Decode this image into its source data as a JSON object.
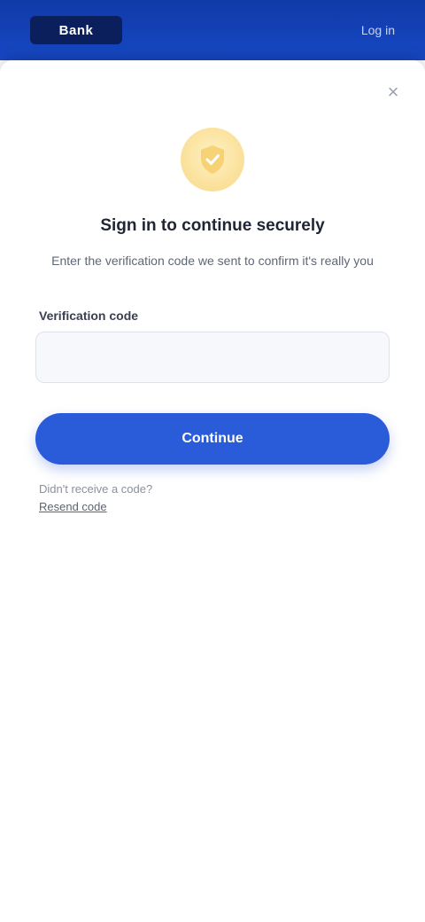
{
  "header": {
    "logo_text": "Bank",
    "account_link": "Log in"
  },
  "sheet": {
    "close_glyph": "×",
    "title": "Sign in to continue securely",
    "subtitle": "Enter the verification code we sent to confirm it's really you",
    "field_label": "Verification code",
    "field_value": "",
    "field_placeholder": "",
    "primary_button": "Continue",
    "helper_text": "Didn't receive a code?",
    "helper_link": "Resend code"
  },
  "colors": {
    "header_bg": "#1748c4",
    "primary": "#2a5bd9",
    "illustration": "#fbe3a0"
  },
  "icons": {
    "illustration": "shield-icon",
    "close": "close-icon"
  }
}
